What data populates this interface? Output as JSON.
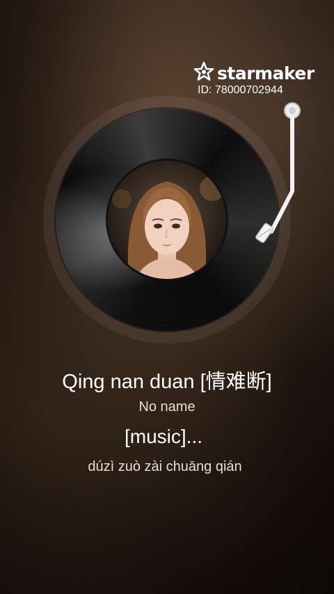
{
  "brand": {
    "logo_icon": "starmaker-star-icon",
    "name": "starmaker",
    "id_text": "ID: 78000702944"
  },
  "player": {
    "disc_icon": "vinyl-record",
    "tonearm_icon": "tonearm",
    "cover_image": "singer-portrait"
  },
  "song": {
    "title": "Qing nan duan [情难断]",
    "artist": "No name"
  },
  "lyrics": {
    "current_line": "[music]...",
    "next_line": "dúzì zuò zài chuāng qián"
  }
}
